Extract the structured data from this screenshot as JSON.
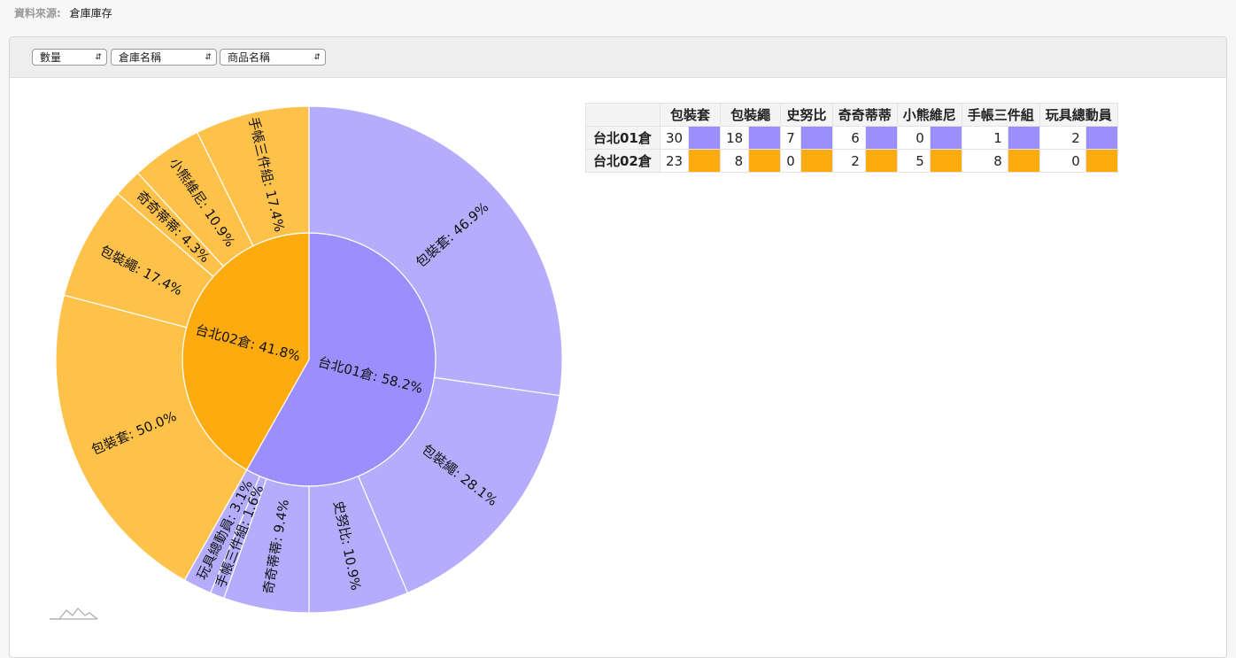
{
  "source": {
    "label": "資料來源:",
    "value": "倉庫庫存"
  },
  "toolbar": {
    "measure_select": "數量",
    "row_select": "倉庫名稱",
    "col_select": "商品名稱"
  },
  "colors": {
    "台北01倉_inner": "#9c8ffd",
    "台北01倉_outer": "#b5adfc",
    "台北02倉_inner": "#fdab0e",
    "台北02倉_outer": "#fec24b"
  },
  "chart_data": {
    "type": "sunburst",
    "products": [
      "包裝套",
      "包裝繩",
      "史努比",
      "奇奇蒂蒂",
      "小熊維尼",
      "手帳三件組",
      "玩具總動員"
    ],
    "warehouses": [
      {
        "name": "台北01倉",
        "share_label": "台北01倉: 58.2%",
        "values": [
          30,
          18,
          7,
          6,
          0,
          1,
          2
        ]
      },
      {
        "name": "台北02倉",
        "share_label": "台北02倉: 41.8%",
        "values": [
          23,
          8,
          0,
          2,
          5,
          8,
          0
        ]
      }
    ],
    "outer_labels": {
      "台北01倉": [
        "包裝套: 46.9%",
        "包裝繩: 28.1%",
        "史努比: 10.9%",
        "奇奇蒂蒂: 9.4%",
        "",
        "手帳三件組: 1.6%",
        "玩具總動員: 3.1%"
      ],
      "台北02倉": [
        "包裝套: 50.0%",
        "包裝繩: 17.4%",
        "",
        "奇奇蒂蒂: 4.3%",
        "小熊維尼: 10.9%",
        "手帳三件組: 17.4%",
        ""
      ]
    }
  },
  "legend_table": {
    "corner": "",
    "headers": [
      "包裝套",
      "包裝繩",
      "史努比",
      "奇奇蒂蒂",
      "小熊維尼",
      "手帳三件組",
      "玩具總動員"
    ],
    "rows": [
      {
        "name": "台北01倉",
        "values": [
          "30",
          "18",
          "7",
          "6",
          "0",
          "1",
          "2"
        ],
        "color": "#9c8ffd"
      },
      {
        "name": "台北02倉",
        "values": [
          "23",
          "8",
          "0",
          "2",
          "5",
          "8",
          "0"
        ],
        "color": "#fdab0e"
      }
    ]
  }
}
